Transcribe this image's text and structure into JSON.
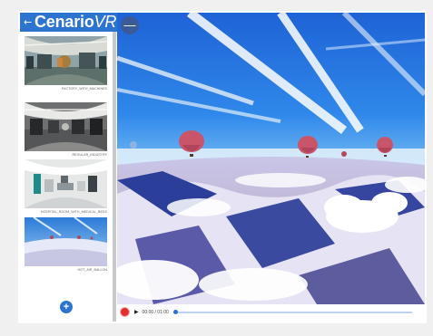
{
  "app": {
    "brand_main": "Cenario",
    "brand_vr": "VR",
    "back_glyph": "←",
    "collapse_glyph": "—",
    "accent": "#2c74d0"
  },
  "sidebar": {
    "scenes": [
      {
        "label": "FACTORY_WITH_MACHINES",
        "icon": "factory-thumbnail"
      },
      {
        "label": "REGULAR_INDUSTRY",
        "icon": "industry-thumbnail"
      },
      {
        "label": "HOSPITAL_ROOM_WITH_MEDICAL_BEDS",
        "icon": "hospital-thumbnail"
      },
      {
        "label": "HOT_AIR_BALLON",
        "icon": "balloon-thumbnail"
      }
    ],
    "add_glyph": "+"
  },
  "player": {
    "play_glyph": "▶",
    "time": "00:00 / 01:00",
    "progress": 0.0
  }
}
